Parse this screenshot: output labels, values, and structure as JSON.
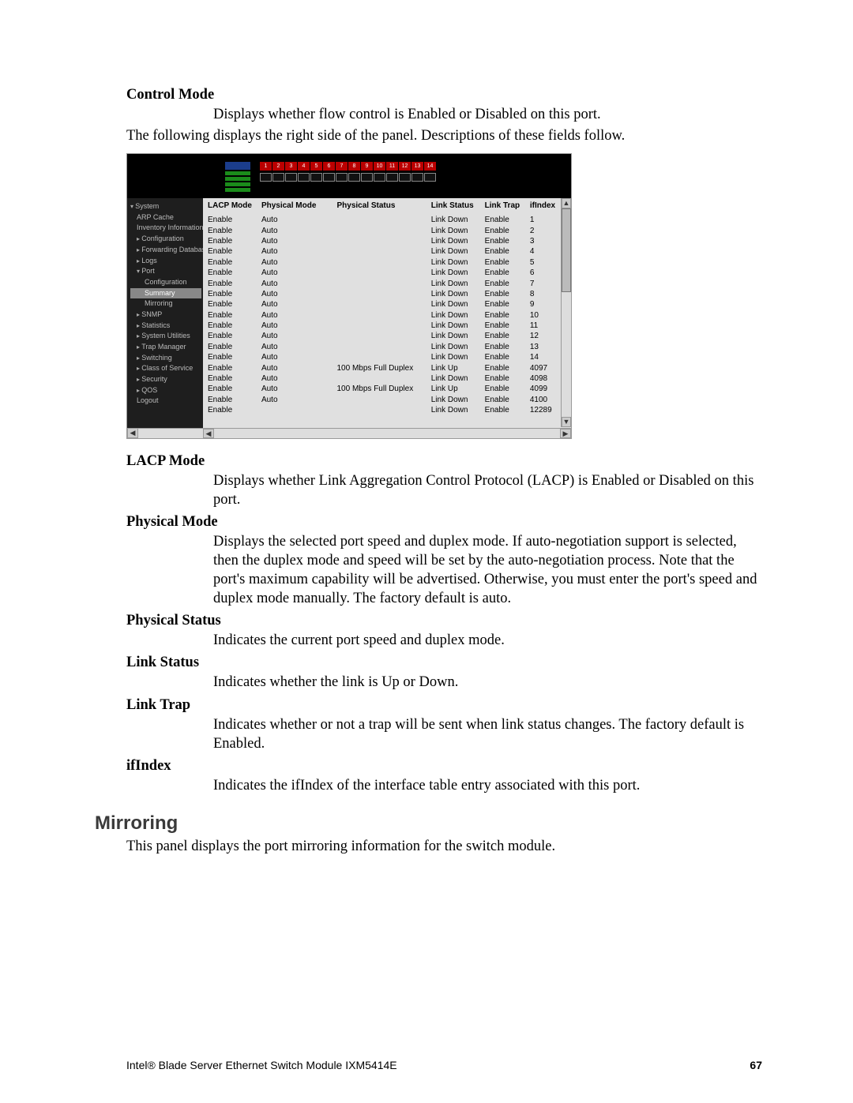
{
  "definitions": {
    "control_mode": {
      "term": "Control Mode",
      "desc": "Displays whether flow control is Enabled or Disabled on this port."
    },
    "lead_in": "The following displays the right side of the panel. Descriptions of these fields follow.",
    "lacp_mode": {
      "term": "LACP Mode",
      "desc": "Displays whether Link Aggregation Control Protocol (LACP) is Enabled or Disabled on this port."
    },
    "physical_mode": {
      "term": "Physical Mode",
      "desc": "Displays the selected port speed and duplex mode. If auto-negotiation support is selected, then the duplex mode and speed will be set by the auto-negotiation process. Note that the port's maximum capability will be advertised. Otherwise, you must enter the port's speed and duplex mode manually. The factory default is auto."
    },
    "physical_status": {
      "term": "Physical Status",
      "desc": "Indicates the current port speed and duplex mode."
    },
    "link_status": {
      "term": "Link Status",
      "desc": "Indicates whether the link is Up or Down."
    },
    "link_trap": {
      "term": "Link Trap",
      "desc": "Indicates whether or not a trap will be sent when link status changes. The factory default is Enabled."
    },
    "if_index": {
      "term": "ifIndex",
      "desc": "Indicates the ifIndex of the interface table entry associated with this port."
    }
  },
  "mirroring": {
    "heading": "Mirroring",
    "desc": "This panel displays the port mirroring information for the switch module."
  },
  "footer": {
    "product": "Intel® Blade Server Ethernet Switch Module IXM5414E",
    "page": "67"
  },
  "screenshot": {
    "port_numbers": [
      "1",
      "2",
      "3",
      "4",
      "5",
      "6",
      "7",
      "8",
      "9",
      "10",
      "11",
      "12",
      "13",
      "14"
    ],
    "nav": [
      {
        "label": "System",
        "cls": "lvl0"
      },
      {
        "label": "ARP Cache",
        "cls": "lvl1"
      },
      {
        "label": "Inventory Information",
        "cls": "lvl1"
      },
      {
        "label": "Configuration",
        "cls": "lvl1 expand"
      },
      {
        "label": "Forwarding Database",
        "cls": "lvl1 expand"
      },
      {
        "label": "Logs",
        "cls": "lvl1 expand"
      },
      {
        "label": "Port",
        "cls": "lvl1 expanded"
      },
      {
        "label": "Configuration",
        "cls": "lvl2"
      },
      {
        "label": "Summary",
        "cls": "lvl2 sel"
      },
      {
        "label": "Mirroring",
        "cls": "lvl2"
      },
      {
        "label": "SNMP",
        "cls": "lvl1 expand"
      },
      {
        "label": "Statistics",
        "cls": "lvl1 expand"
      },
      {
        "label": "System Utilities",
        "cls": "lvl1 expand"
      },
      {
        "label": "Trap Manager",
        "cls": "lvl1 expand"
      },
      {
        "label": "Switching",
        "cls": "lvl1 expand"
      },
      {
        "label": "Class of Service",
        "cls": "lvl1 expand"
      },
      {
        "label": "Security",
        "cls": "lvl1 expand"
      },
      {
        "label": "QOS",
        "cls": "lvl1 expand"
      },
      {
        "label": "Logout",
        "cls": "lvl1"
      }
    ],
    "columns": {
      "lacp_mode": "LACP Mode",
      "physical_mode": "Physical Mode",
      "physical_status": "Physical Status",
      "link_status": "Link Status",
      "link_trap": "Link Trap",
      "if_index": "ifIndex"
    },
    "rows": [
      {
        "lacp": "Enable",
        "pmode": "Auto",
        "pstat": "",
        "lstat": "Link Down",
        "ltrap": "Enable",
        "ifidx": "1"
      },
      {
        "lacp": "Enable",
        "pmode": "Auto",
        "pstat": "",
        "lstat": "Link Down",
        "ltrap": "Enable",
        "ifidx": "2"
      },
      {
        "lacp": "Enable",
        "pmode": "Auto",
        "pstat": "",
        "lstat": "Link Down",
        "ltrap": "Enable",
        "ifidx": "3"
      },
      {
        "lacp": "Enable",
        "pmode": "Auto",
        "pstat": "",
        "lstat": "Link Down",
        "ltrap": "Enable",
        "ifidx": "4"
      },
      {
        "lacp": "Enable",
        "pmode": "Auto",
        "pstat": "",
        "lstat": "Link Down",
        "ltrap": "Enable",
        "ifidx": "5"
      },
      {
        "lacp": "Enable",
        "pmode": "Auto",
        "pstat": "",
        "lstat": "Link Down",
        "ltrap": "Enable",
        "ifidx": "6"
      },
      {
        "lacp": "Enable",
        "pmode": "Auto",
        "pstat": "",
        "lstat": "Link Down",
        "ltrap": "Enable",
        "ifidx": "7"
      },
      {
        "lacp": "Enable",
        "pmode": "Auto",
        "pstat": "",
        "lstat": "Link Down",
        "ltrap": "Enable",
        "ifidx": "8"
      },
      {
        "lacp": "Enable",
        "pmode": "Auto",
        "pstat": "",
        "lstat": "Link Down",
        "ltrap": "Enable",
        "ifidx": "9"
      },
      {
        "lacp": "Enable",
        "pmode": "Auto",
        "pstat": "",
        "lstat": "Link Down",
        "ltrap": "Enable",
        "ifidx": "10"
      },
      {
        "lacp": "Enable",
        "pmode": "Auto",
        "pstat": "",
        "lstat": "Link Down",
        "ltrap": "Enable",
        "ifidx": "11"
      },
      {
        "lacp": "Enable",
        "pmode": "Auto",
        "pstat": "",
        "lstat": "Link Down",
        "ltrap": "Enable",
        "ifidx": "12"
      },
      {
        "lacp": "Enable",
        "pmode": "Auto",
        "pstat": "",
        "lstat": "Link Down",
        "ltrap": "Enable",
        "ifidx": "13"
      },
      {
        "lacp": "Enable",
        "pmode": "Auto",
        "pstat": "",
        "lstat": "Link Down",
        "ltrap": "Enable",
        "ifidx": "14"
      },
      {
        "lacp": "Enable",
        "pmode": "Auto",
        "pstat": "100 Mbps Full Duplex",
        "lstat": "Link Up",
        "ltrap": "Enable",
        "ifidx": "4097"
      },
      {
        "lacp": "Enable",
        "pmode": "Auto",
        "pstat": "",
        "lstat": "Link Down",
        "ltrap": "Enable",
        "ifidx": "4098"
      },
      {
        "lacp": "Enable",
        "pmode": "Auto",
        "pstat": "100 Mbps Full Duplex",
        "lstat": "Link Up",
        "ltrap": "Enable",
        "ifidx": "4099"
      },
      {
        "lacp": "Enable",
        "pmode": "Auto",
        "pstat": "",
        "lstat": "Link Down",
        "ltrap": "Enable",
        "ifidx": "4100"
      },
      {
        "lacp": "Enable",
        "pmode": "",
        "pstat": "",
        "lstat": "Link Down",
        "ltrap": "Enable",
        "ifidx": "12289"
      }
    ]
  }
}
